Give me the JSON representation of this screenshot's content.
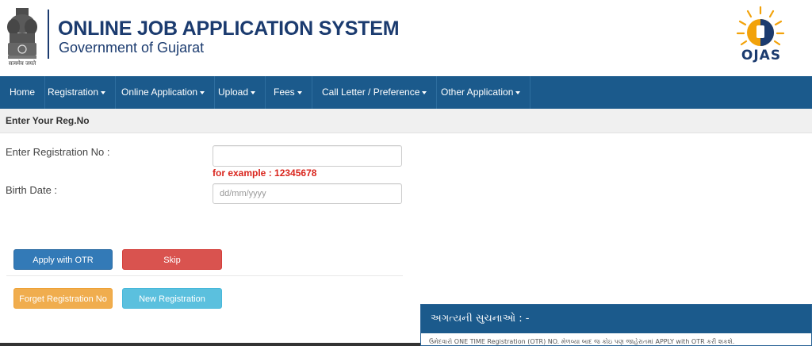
{
  "header": {
    "title": "ONLINE JOB APPLICATION SYSTEM",
    "subtitle": "Government of Gujarat",
    "emblem_caption": "सत्यमेव जयते",
    "logo_text": "OJAS"
  },
  "nav": {
    "items": [
      {
        "label": "Home",
        "dropdown": false
      },
      {
        "label": "Registration",
        "dropdown": true
      },
      {
        "label": "Online Application",
        "dropdown": true
      },
      {
        "label": "Upload",
        "dropdown": true
      },
      {
        "label": "Fees",
        "dropdown": true
      },
      {
        "label": "Call Letter / Preference",
        "dropdown": true
      },
      {
        "label": "Other Application",
        "dropdown": true
      }
    ]
  },
  "form": {
    "section_title": "Enter Your Reg.No",
    "reg_label": "Enter Registration No :",
    "reg_value": "",
    "reg_placeholder": "",
    "example_text": "for example : 12345678",
    "birth_label": "Birth Date :",
    "birth_placeholder": "dd/mm/yyyy"
  },
  "buttons": {
    "apply_otr": "Apply with OTR",
    "skip": "Skip",
    "forget_reg": "Forget Registration No",
    "new_reg": "New Registration"
  },
  "notice": {
    "title": "અગત્યની સુચનાઓ : -",
    "body": "ઉમેદવારો ONE TIME Registration (OTR) NO. મેળવ્યા બાદ જ કોઇ પણ જાહેરાતમાં APPLY with OTR કરી શકશે."
  },
  "colors": {
    "brand_navy": "#1b3b6f",
    "nav_blue": "#1b5a8c",
    "example_red": "#d9251d"
  }
}
